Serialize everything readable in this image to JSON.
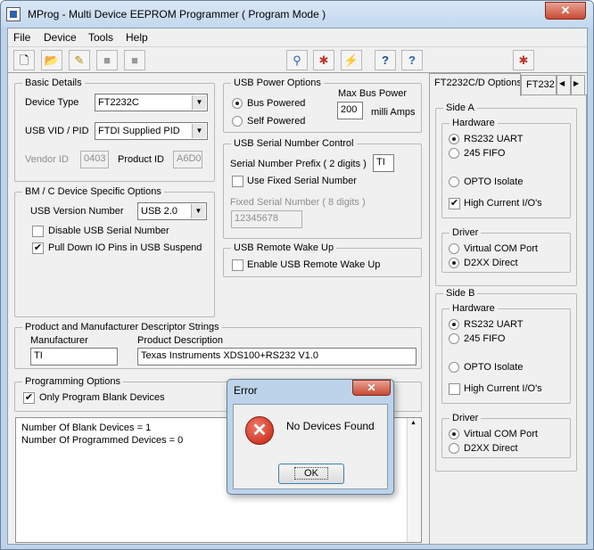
{
  "window": {
    "title": "MProg - Multi Device EEPROM Programmer ( Program Mode )",
    "close_glyph": "✕"
  },
  "menu": {
    "items": [
      "File",
      "Device",
      "Tools",
      "Help"
    ]
  },
  "toolbar": {
    "buttons": [
      "new-icon",
      "open-icon",
      "edit-icon",
      "save-icon",
      "save-as-icon",
      "scan-icon",
      "cancel-icon",
      "program-icon",
      "help-icon",
      "about-icon",
      "close-file-icon"
    ]
  },
  "basic_details": {
    "title": "Basic Details",
    "device_type_label": "Device Type",
    "device_type_value": "FT2232C",
    "usb_vid_pid_label": "USB VID / PID",
    "usb_vid_pid_value": "FTDI Supplied PID",
    "vendor_id_label": "Vendor ID",
    "vendor_id_value": "0403",
    "product_id_label": "Product ID",
    "product_id_value": "A6D0"
  },
  "bm_options": {
    "title": "BM / C Device Specific Options",
    "usb_version_label": "USB Version Number",
    "usb_version_value": "USB 2.0",
    "disable_serial_label": "Disable USB Serial Number",
    "disable_serial_checked": false,
    "pulldown_label": "Pull Down IO Pins in USB Suspend",
    "pulldown_checked": true
  },
  "usb_power": {
    "title": "USB Power Options",
    "bus_powered_label": "Bus Powered",
    "self_powered_label": "Self Powered",
    "selected": "bus",
    "max_bus_power_label": "Max Bus Power",
    "max_bus_power_value": "200",
    "units_label": "milli Amps"
  },
  "serial_control": {
    "title": "USB Serial Number Control",
    "prefix_label": "Serial Number Prefix ( 2 digits )",
    "prefix_value": "TI",
    "use_fixed_label": "Use Fixed Serial Number",
    "use_fixed_checked": false,
    "fixed_label": "Fixed Serial Number ( 8 digits )",
    "fixed_value": "12345678"
  },
  "remote_wake": {
    "title": "USB Remote Wake Up",
    "enable_label": "Enable USB Remote Wake Up",
    "enable_checked": false
  },
  "descriptors": {
    "title": "Product and Manufacturer Descriptor Strings",
    "manufacturer_label": "Manufacturer",
    "manufacturer_value": "TI",
    "product_label": "Product Description",
    "product_value": "Texas Instruments XDS100+RS232 V1.0"
  },
  "programming": {
    "title": "Programming Options",
    "only_blank_label": "Only Program Blank Devices",
    "only_blank_checked": true
  },
  "log": {
    "lines": [
      "Number Of Blank Devices = 1",
      "Number Of Programmed Devices = 0"
    ]
  },
  "tabs": {
    "labels": [
      "FT2232C/D Options",
      "FT232"
    ],
    "scroll_left": "◀",
    "scroll_right": "▶",
    "side_a": {
      "title": "Side A",
      "hardware_title": "Hardware",
      "rs232_label": "RS232 UART",
      "fifo_label": "245 FIFO",
      "opto_label": "OPTO Isolate",
      "hardware_selected": "rs232",
      "high_current_label": "High Current I/O's",
      "high_current_checked": true,
      "driver_title": "Driver",
      "vcp_label": "Virtual COM Port",
      "d2xx_label": "D2XX Direct",
      "driver_selected": "d2xx"
    },
    "side_b": {
      "title": "Side B",
      "hardware_title": "Hardware",
      "rs232_label": "RS232 UART",
      "fifo_label": "245 FIFO",
      "opto_label": "OPTO Isolate",
      "hardware_selected": "rs232",
      "high_current_label": "High Current I/O's",
      "high_current_checked": false,
      "driver_title": "Driver",
      "vcp_label": "Virtual COM Port",
      "d2xx_label": "D2XX Direct",
      "driver_selected": "vcp"
    }
  },
  "dialog": {
    "title": "Error",
    "message": "No Devices Found",
    "ok_label": "OK",
    "icon": "error-icon",
    "close_glyph": "✕",
    "error_glyph": "✕"
  },
  "colors": {
    "titlebar": "#c3d8ee",
    "close": "#c74a35",
    "face": "#f0f0f0"
  }
}
